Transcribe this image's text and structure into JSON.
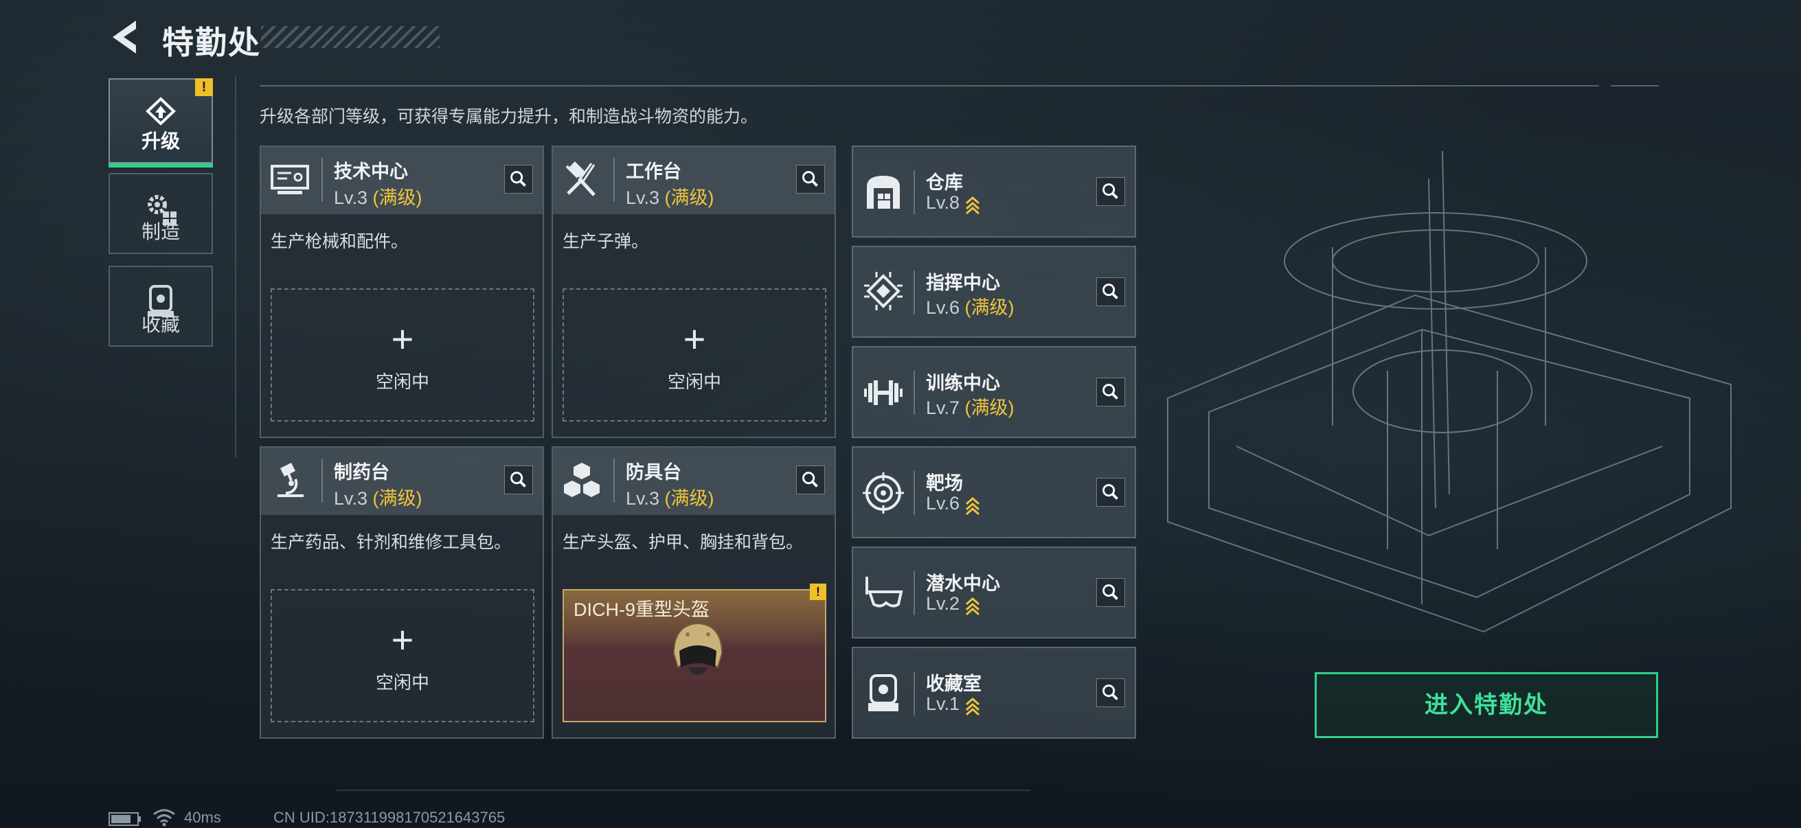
{
  "header": {
    "title": "特勤处"
  },
  "description": "升级各部门等级，可获得专属能力提升，和制造战斗物资的能力。",
  "nav": {
    "items": [
      {
        "label": "升级",
        "icon": "upgrade-icon",
        "active": true,
        "alert": "!"
      },
      {
        "label": "制造",
        "icon": "gears-icon",
        "active": false
      },
      {
        "label": "收藏",
        "icon": "collection-icon",
        "active": false
      }
    ]
  },
  "cards": [
    {
      "name": "技术中心",
      "level": "Lv.3",
      "max_label": "(满级)",
      "desc": "生产枪械和配件。",
      "slot_text": "空闲中",
      "icon": "monitor-icon"
    },
    {
      "name": "工作台",
      "level": "Lv.3",
      "max_label": "(满级)",
      "desc": "生产子弹。",
      "slot_text": "空闲中",
      "icon": "hammer-wrench-icon"
    },
    {
      "name": "制药台",
      "level": "Lv.3",
      "max_label": "(满级)",
      "desc": "生产药品、针剂和维修工具包。",
      "slot_text": "空闲中",
      "icon": "microscope-icon"
    },
    {
      "name": "防具台",
      "level": "Lv.3",
      "max_label": "(满级)",
      "desc": "生产头盔、护甲、胸挂和背包。",
      "icon": "armor-blocks-icon",
      "item": {
        "name": "DICH-9重型头盔",
        "alert": "!"
      }
    }
  ],
  "facilities": [
    {
      "name": "仓库",
      "level": "Lv.8",
      "max_label": "",
      "upgradable": true,
      "icon": "warehouse-icon"
    },
    {
      "name": "指挥中心",
      "level": "Lv.6",
      "max_label": "(满级)",
      "upgradable": false,
      "icon": "command-chip-icon"
    },
    {
      "name": "训练中心",
      "level": "Lv.7",
      "max_label": "(满级)",
      "upgradable": false,
      "icon": "dumbbell-icon"
    },
    {
      "name": "靶场",
      "level": "Lv.6",
      "max_label": "",
      "upgradable": true,
      "icon": "target-icon"
    },
    {
      "name": "潜水中心",
      "level": "Lv.2",
      "max_label": "",
      "upgradable": true,
      "icon": "diving-mask-icon"
    },
    {
      "name": "收藏室",
      "level": "Lv.1",
      "max_label": "",
      "upgradable": true,
      "icon": "display-case-icon"
    }
  ],
  "enter_button": "进入特勤处",
  "status": {
    "ping": "40ms",
    "uid": "CN UID:18731199817052164376​5"
  },
  "colors": {
    "accent_green": "#2fd08a",
    "max_gold": "#f0c53a",
    "alert_yellow": "#f0c028"
  }
}
